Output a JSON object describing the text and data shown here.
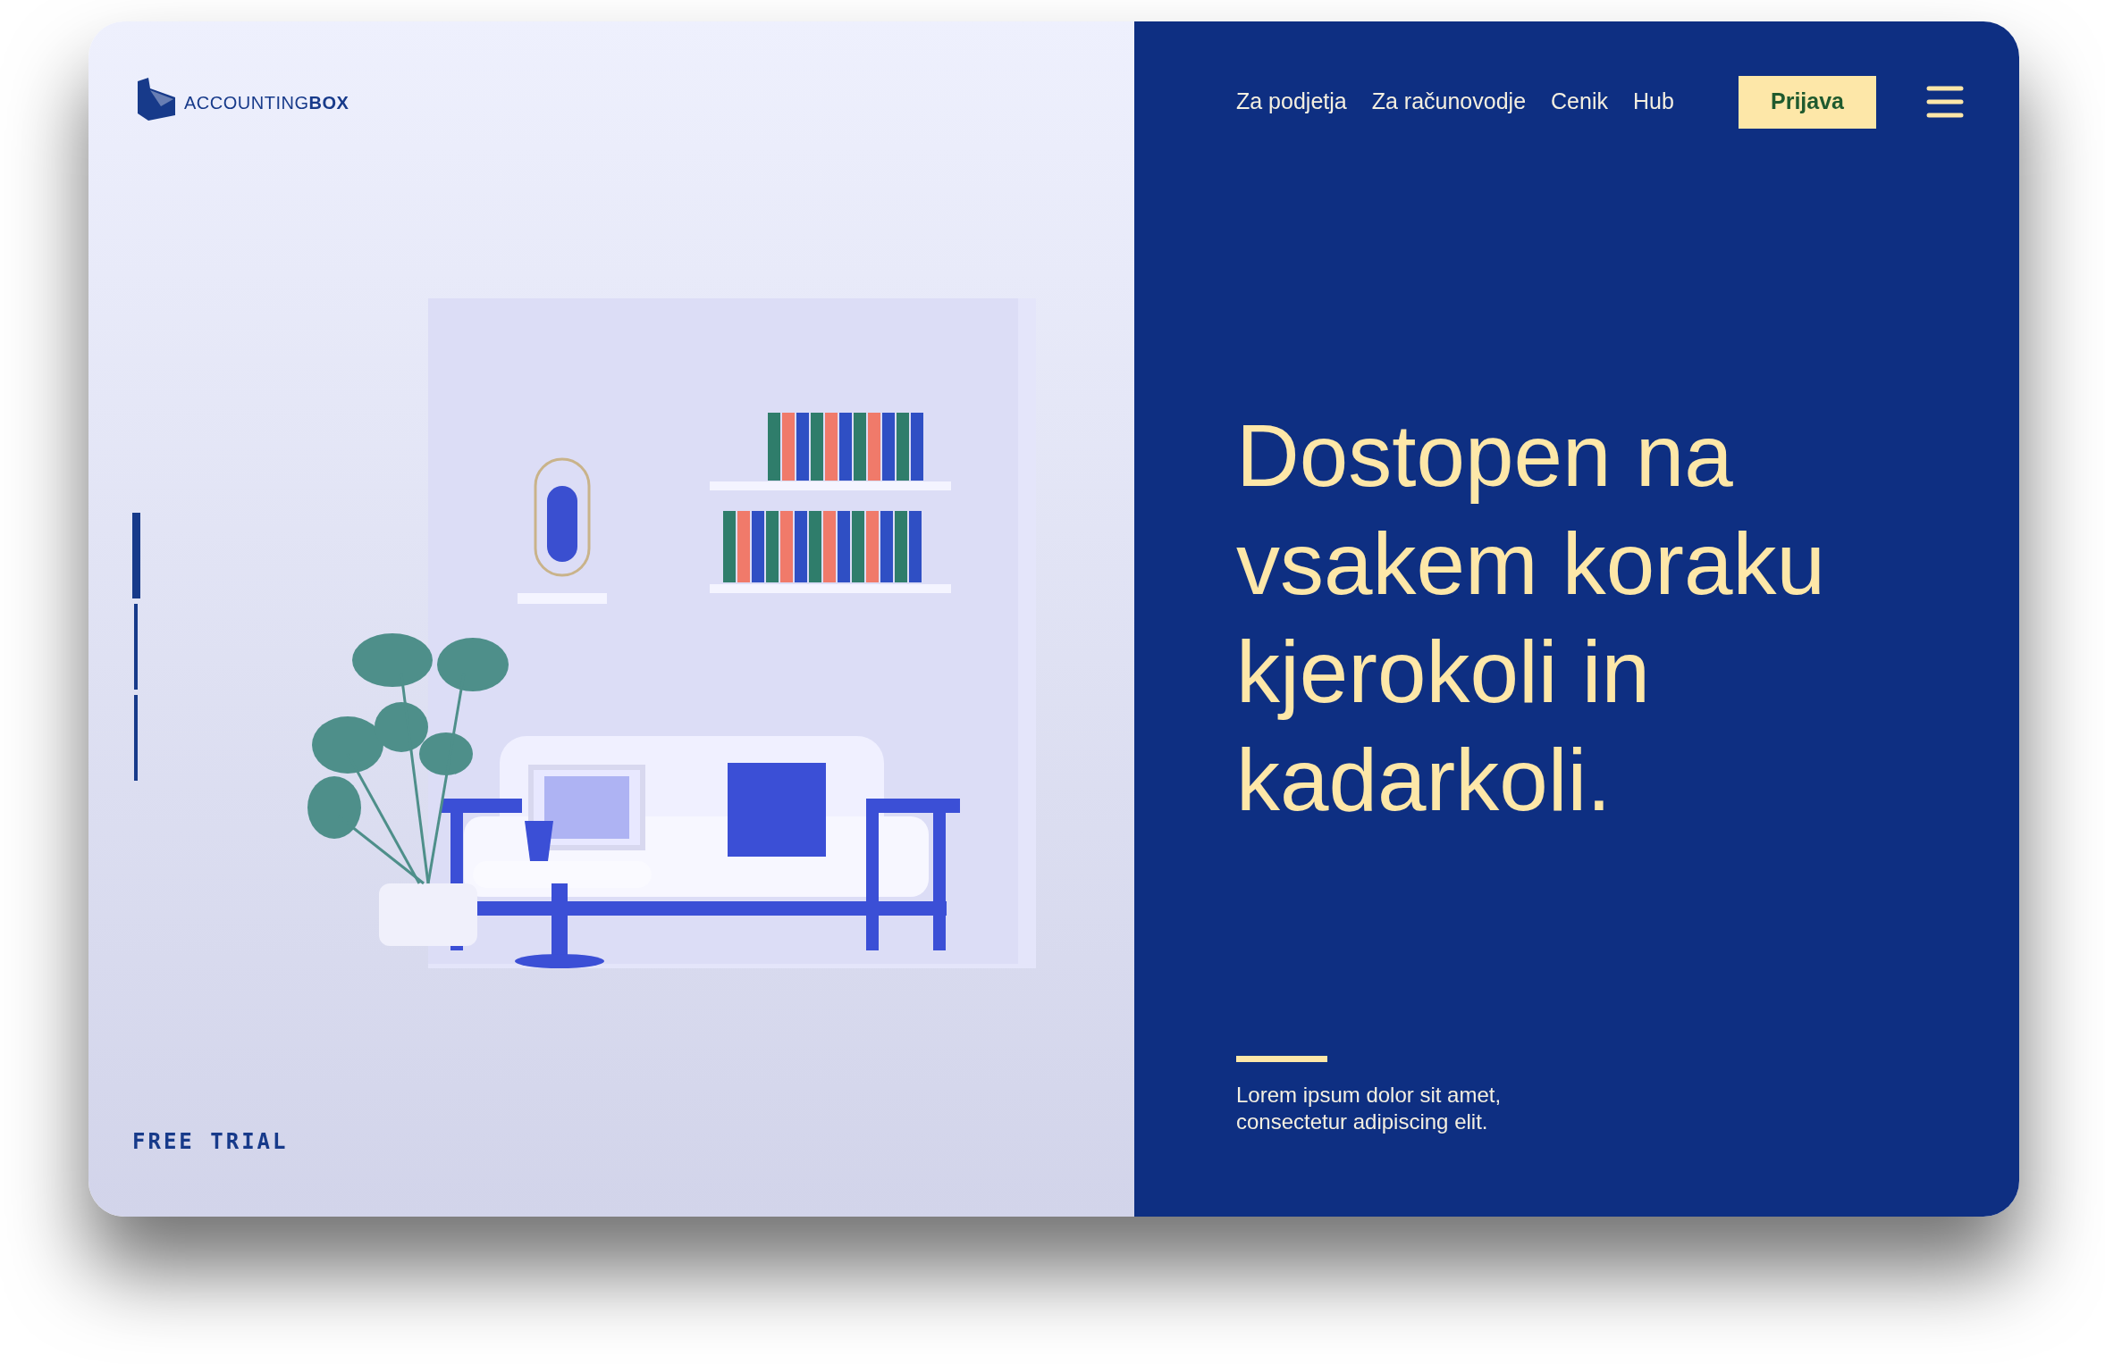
{
  "logo": {
    "text_light": "ACCOUNTING",
    "text_bold": "BOX"
  },
  "nav": {
    "links": [
      "Za podjetja",
      "Za računovodje",
      "Cenik",
      "Hub"
    ],
    "login_button": "Prijava"
  },
  "slides": [
    {
      "selected": true
    },
    {
      "selected": false
    },
    {
      "selected": false
    }
  ],
  "free_trial": "FREE TRIAL",
  "hero": {
    "heading": "Dostopen na vsakem koraku kjerokoli in kadarkoli.",
    "subtext": "Lorem ipsum dolor sit amet, consectetur adipiscing elit."
  }
}
